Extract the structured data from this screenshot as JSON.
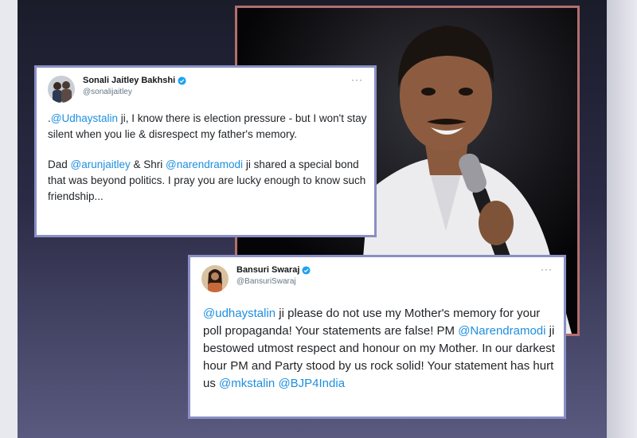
{
  "tweet1": {
    "name": "Sonali Jaitley Bakhshi",
    "handle": "@sonalijaitley",
    "more": "···",
    "p1_pre": ".",
    "p1_m1": "@Udhaystalin",
    "p1_post": " ji, I know there is election pressure - but I won't stay silent when you lie & disrespect my father's memory.",
    "p2_pre": "Dad ",
    "p2_m1": "@arunjaitley",
    "p2_mid": " & Shri ",
    "p2_m2": "@narendramodi",
    "p2_post": " ji shared a special bond that was beyond politics. I pray you are lucky enough to know such friendship..."
  },
  "tweet2": {
    "name": "Bansuri Swaraj",
    "handle": "@BansuriSwaraj",
    "more": "···",
    "m1": "@udhaystalin",
    "t1": " ji please do not use my Mother's memory for your poll propaganda! Your statements are false!  PM ",
    "m2": "@Narendramodi",
    "t2": " ji bestowed utmost respect and honour on my Mother. In our darkest hour PM and Party stood by us rock solid! Your statement has hurt us ",
    "m3": "@mkstalin",
    "t3": " ",
    "m4": "@BJP4India"
  },
  "colors": {
    "mention": "#1d8fe0",
    "verified": "#1da1f2",
    "tweet_border": "#8a8fc4",
    "photo_border": "#b26e6e"
  }
}
